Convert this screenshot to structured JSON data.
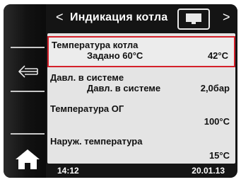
{
  "header": {
    "title": "Индикация котла",
    "prev_arrow": "<",
    "next_arrow": ">",
    "monitor_icon": "monitor-icon"
  },
  "nav": {
    "back_icon": "back-arrow-icon",
    "home_icon": "home-icon"
  },
  "items": [
    {
      "label": "Температура котла",
      "sub": "Задано 60°C",
      "value": "42°C",
      "selected": true
    },
    {
      "label": "Давл. в системе",
      "sub": "Давл. в системе",
      "value": "2,0бар"
    },
    {
      "label": "Температура ОГ",
      "value": "100°C"
    },
    {
      "label": "Наруж. температура",
      "value": "15°C"
    }
  ],
  "footer": {
    "time": "14:12",
    "date": "20.01.13"
  },
  "colors": {
    "selection_border": "#d4202a",
    "background": "#151515",
    "panel": "#e4e4e4"
  }
}
